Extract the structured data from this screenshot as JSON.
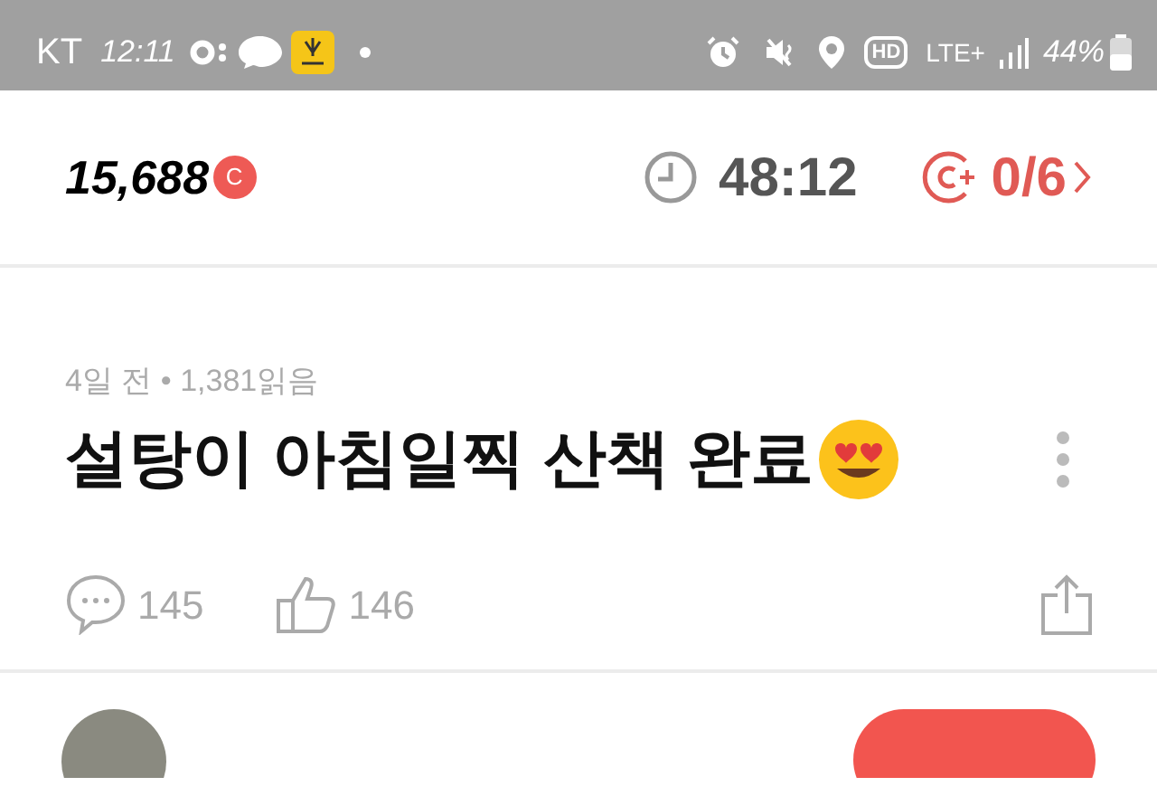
{
  "status_bar": {
    "carrier": "KT",
    "time": "12:11",
    "network": "LTE+",
    "hd": "HD",
    "battery": "44%"
  },
  "header": {
    "coins": "15,688",
    "coin_badge": "C",
    "timer": "48:12",
    "mission": "0/6"
  },
  "post": {
    "meta": "4일 전 • 1,381읽음",
    "title": "설탕이 아침일찍 산책 완료",
    "comments": "145",
    "likes": "146"
  }
}
